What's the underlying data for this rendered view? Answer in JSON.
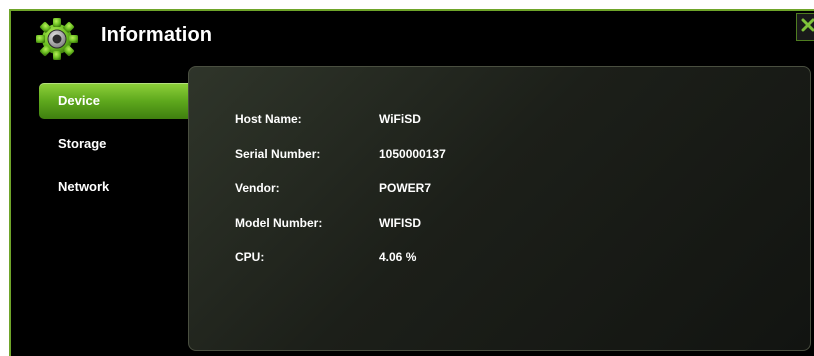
{
  "header": {
    "title": "Information",
    "icon": "gear-icon",
    "close_icon": "close-icon"
  },
  "colors": {
    "accent": "#6fa52a",
    "active_tab": "#5ea81d",
    "background": "#000000",
    "panel": "#1c1f19"
  },
  "sidebar": {
    "items": [
      {
        "label": "Device",
        "active": true
      },
      {
        "label": "Storage",
        "active": false
      },
      {
        "label": "Network",
        "active": false
      }
    ]
  },
  "device_info": {
    "rows": [
      {
        "label": "Host Name:",
        "value": "WiFiSD"
      },
      {
        "label": "Serial Number:",
        "value": "1050000137"
      },
      {
        "label": "Vendor:",
        "value": "POWER7"
      },
      {
        "label": "Model Number:",
        "value": "WIFISD"
      },
      {
        "label": "CPU:",
        "value": "4.06 %"
      }
    ]
  }
}
